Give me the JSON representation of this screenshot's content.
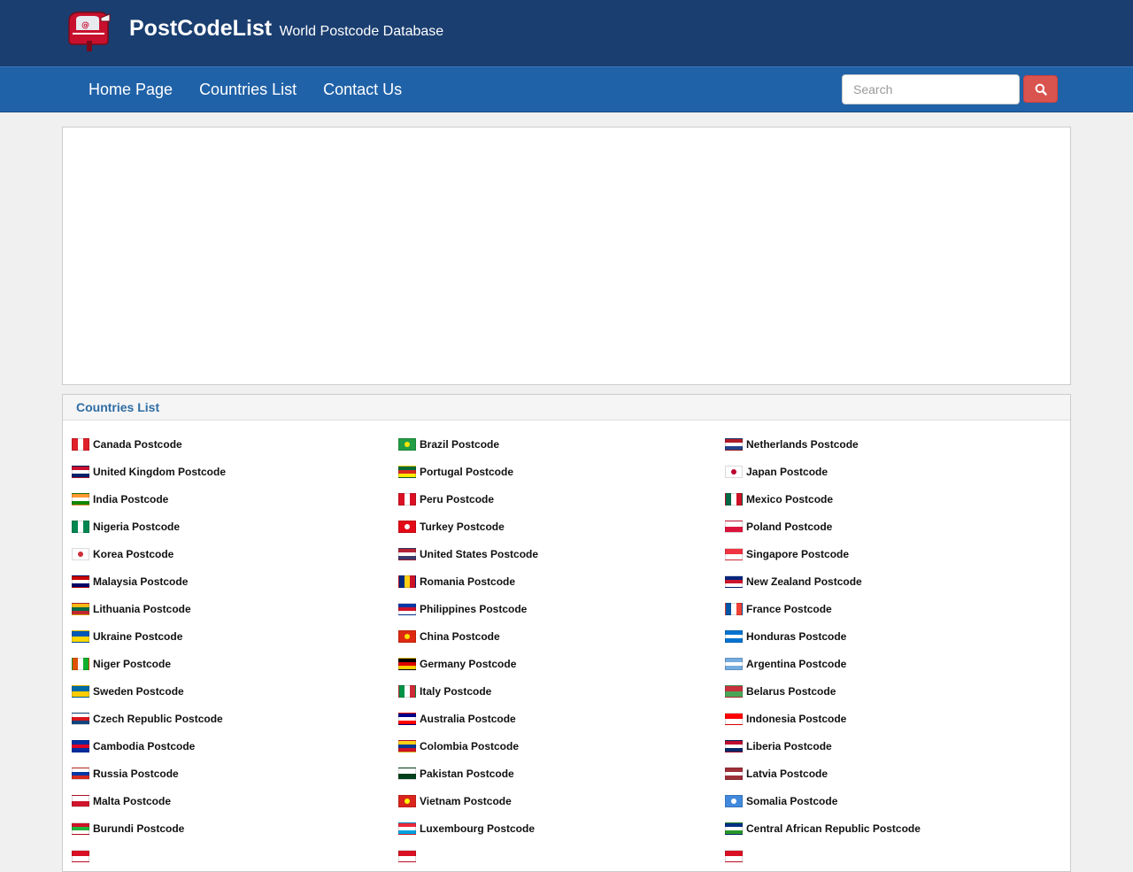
{
  "header": {
    "brand_title": "PostCodeList",
    "brand_subtitle": "World Postcode Database",
    "logo_icon": "mailbox-icon"
  },
  "nav": {
    "items": [
      {
        "label": "Home Page"
      },
      {
        "label": "Countries List"
      },
      {
        "label": "Contact Us"
      }
    ],
    "search_placeholder": "Search",
    "search_icon": "search-icon"
  },
  "countries_panel": {
    "title": "Countries List",
    "items": [
      {
        "label": "Canada Postcode",
        "flag": "canada",
        "colors": [
          "#e0202a",
          "#ffffff",
          "#e0202a"
        ]
      },
      {
        "label": "Brazil Postcode",
        "flag": "brazil",
        "colors": [
          "#229e45",
          "#f8e509",
          "#2b49a3"
        ]
      },
      {
        "label": "Netherlands Postcode",
        "flag": "netherlands",
        "colors": [
          "#ae1c28",
          "#ffffff",
          "#21468b"
        ]
      },
      {
        "label": "United Kingdom Postcode",
        "flag": "united-kingdom",
        "colors": [
          "#c8102e",
          "#ffffff",
          "#012169"
        ]
      },
      {
        "label": "Portugal Postcode",
        "flag": "portugal",
        "colors": [
          "#046a38",
          "#da291c",
          "#ffe900"
        ]
      },
      {
        "label": "Japan Postcode",
        "flag": "japan",
        "colors": [
          "#ffffff",
          "#bc002d"
        ]
      },
      {
        "label": "India Postcode",
        "flag": "india",
        "colors": [
          "#ff9933",
          "#ffffff",
          "#138808"
        ]
      },
      {
        "label": "Peru Postcode",
        "flag": "peru",
        "colors": [
          "#d91023",
          "#ffffff",
          "#d91023"
        ]
      },
      {
        "label": "Mexico Postcode",
        "flag": "mexico",
        "colors": [
          "#006847",
          "#ffffff",
          "#ce1126"
        ]
      },
      {
        "label": "Nigeria Postcode",
        "flag": "nigeria",
        "colors": [
          "#008751",
          "#ffffff",
          "#008751"
        ]
      },
      {
        "label": "Turkey Postcode",
        "flag": "turkey",
        "colors": [
          "#e30a17",
          "#ffffff"
        ]
      },
      {
        "label": "Poland Postcode",
        "flag": "poland",
        "colors": [
          "#ffffff",
          "#dc143c"
        ]
      },
      {
        "label": "Korea Postcode",
        "flag": "korea",
        "colors": [
          "#ffffff",
          "#cd2e3a",
          "#0047a0"
        ]
      },
      {
        "label": "United States Postcode",
        "flag": "united-states",
        "colors": [
          "#b22234",
          "#ffffff",
          "#3c3b6e"
        ]
      },
      {
        "label": "Singapore Postcode",
        "flag": "singapore",
        "colors": [
          "#ef3340",
          "#ffffff"
        ]
      },
      {
        "label": "Malaysia Postcode",
        "flag": "malaysia",
        "colors": [
          "#cc0001",
          "#ffffff",
          "#010066"
        ]
      },
      {
        "label": "Romania Postcode",
        "flag": "romania",
        "colors": [
          "#002b7f",
          "#fcd116",
          "#ce1126"
        ]
      },
      {
        "label": "New Zealand Postcode",
        "flag": "new-zealand",
        "colors": [
          "#00247d",
          "#cc142b",
          "#ffffff"
        ]
      },
      {
        "label": "Lithuania Postcode",
        "flag": "lithuania",
        "colors": [
          "#fdb913",
          "#006a44",
          "#c1272d"
        ]
      },
      {
        "label": "Philippines Postcode",
        "flag": "philippines",
        "colors": [
          "#0038a8",
          "#ce1126",
          "#ffffff"
        ]
      },
      {
        "label": "France Postcode",
        "flag": "france",
        "colors": [
          "#0055a4",
          "#ffffff",
          "#ef4135"
        ]
      },
      {
        "label": "Ukraine Postcode",
        "flag": "ukraine",
        "colors": [
          "#0057b7",
          "#ffd700"
        ]
      },
      {
        "label": "China Postcode",
        "flag": "china",
        "colors": [
          "#de2910",
          "#ffde00"
        ]
      },
      {
        "label": "Honduras Postcode",
        "flag": "honduras",
        "colors": [
          "#0073cf",
          "#ffffff",
          "#0073cf"
        ]
      },
      {
        "label": "Niger Postcode",
        "flag": "niger",
        "colors": [
          "#e05206",
          "#ffffff",
          "#0db02b"
        ]
      },
      {
        "label": "Germany Postcode",
        "flag": "germany",
        "colors": [
          "#000000",
          "#dd0000",
          "#ffce00"
        ]
      },
      {
        "label": "Argentina Postcode",
        "flag": "argentina",
        "colors": [
          "#74acdf",
          "#ffffff",
          "#74acdf"
        ]
      },
      {
        "label": "Sweden Postcode",
        "flag": "sweden",
        "colors": [
          "#006aa7",
          "#fecc00"
        ]
      },
      {
        "label": "Italy Postcode",
        "flag": "italy",
        "colors": [
          "#009246",
          "#ffffff",
          "#ce2b37"
        ]
      },
      {
        "label": "Belarus Postcode",
        "flag": "belarus",
        "colors": [
          "#c8313e",
          "#4aa657"
        ]
      },
      {
        "label": "Czech Republic Postcode",
        "flag": "czech-republic",
        "colors": [
          "#ffffff",
          "#d7141a",
          "#11457e"
        ]
      },
      {
        "label": "Australia Postcode",
        "flag": "australia",
        "colors": [
          "#00008b",
          "#ffffff",
          "#ff0000"
        ]
      },
      {
        "label": "Indonesia Postcode",
        "flag": "indonesia",
        "colors": [
          "#ff0000",
          "#ffffff"
        ]
      },
      {
        "label": "Cambodia Postcode",
        "flag": "cambodia",
        "colors": [
          "#032ea1",
          "#e00025",
          "#032ea1"
        ]
      },
      {
        "label": "Colombia Postcode",
        "flag": "colombia",
        "colors": [
          "#fcd116",
          "#003893",
          "#ce1126"
        ]
      },
      {
        "label": "Liberia Postcode",
        "flag": "liberia",
        "colors": [
          "#bf0a30",
          "#ffffff",
          "#002868"
        ]
      },
      {
        "label": "Russia Postcode",
        "flag": "russia",
        "colors": [
          "#ffffff",
          "#0039a6",
          "#d52b1e"
        ]
      },
      {
        "label": "Pakistan Postcode",
        "flag": "pakistan",
        "colors": [
          "#ffffff",
          "#01411c"
        ]
      },
      {
        "label": "Latvia Postcode",
        "flag": "latvia",
        "colors": [
          "#9e3039",
          "#ffffff",
          "#9e3039"
        ]
      },
      {
        "label": "Malta Postcode",
        "flag": "malta",
        "colors": [
          "#ffffff",
          "#cf142b"
        ]
      },
      {
        "label": "Vietnam Postcode",
        "flag": "vietnam",
        "colors": [
          "#da251d",
          "#ffff00"
        ]
      },
      {
        "label": "Somalia Postcode",
        "flag": "somalia",
        "colors": [
          "#4189dd",
          "#ffffff"
        ]
      },
      {
        "label": "Burundi Postcode",
        "flag": "burundi",
        "colors": [
          "#ce1126",
          "#1eb53a",
          "#ffffff"
        ]
      },
      {
        "label": "Luxembourg Postcode",
        "flag": "luxembourg",
        "colors": [
          "#ed2939",
          "#ffffff",
          "#00a1de"
        ]
      },
      {
        "label": "Central African Republic Postcode",
        "flag": "central-african-republic",
        "colors": [
          "#003082",
          "#ffffff",
          "#289728",
          "#ffce00"
        ]
      },
      {
        "label": "",
        "flag": "partial-1",
        "colors": [
          "#d91023",
          "#ffffff"
        ]
      },
      {
        "label": "",
        "flag": "partial-2",
        "colors": [
          "#d91023",
          "#ffffff"
        ]
      },
      {
        "label": "",
        "flag": "partial-3",
        "colors": [
          "#d91023",
          "#ffffff"
        ]
      }
    ]
  }
}
